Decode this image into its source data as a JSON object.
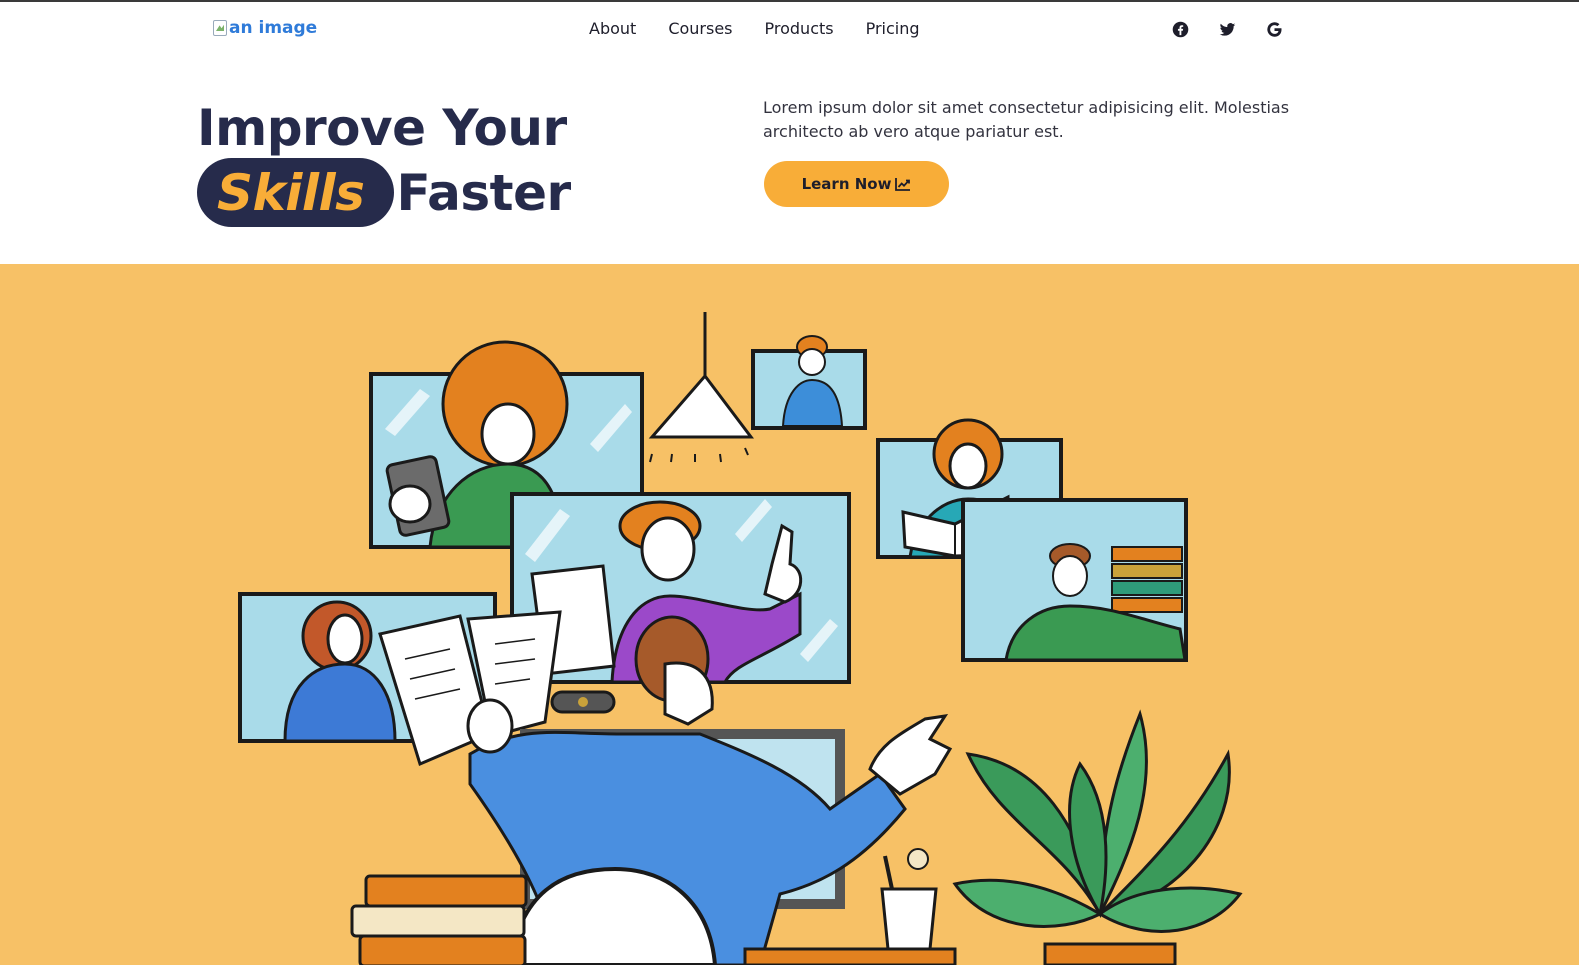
{
  "logo": {
    "alt_text": "an image",
    "icon": "broken-image-icon"
  },
  "nav": {
    "items": [
      "About",
      "Courses",
      "Products",
      "Pricing"
    ]
  },
  "social": [
    {
      "name": "facebook",
      "icon": "facebook-icon"
    },
    {
      "name": "twitter",
      "icon": "twitter-icon"
    },
    {
      "name": "google",
      "icon": "google-icon"
    }
  ],
  "hero": {
    "headline_line1": "Improve Your",
    "headline_highlight": "Skills",
    "headline_line2_rest": "Faster",
    "description": "Lorem ipsum dolor sit amet consectetur adipisicing elit. Molestias architecto ab vero atque pariatur est.",
    "cta_label": "Learn Now",
    "cta_icon": "chart-line-icon"
  },
  "colors": {
    "accent": "#f8ad38",
    "navy": "#262b4b",
    "band": "#f7c166",
    "link": "#2f7bd9"
  }
}
